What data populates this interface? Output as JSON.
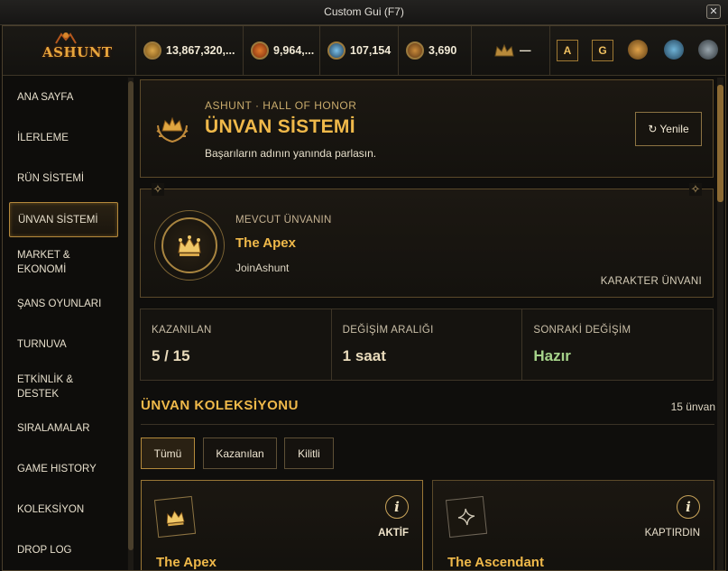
{
  "window": {
    "title": "Custom Gui (F7)"
  },
  "brand": {
    "logo_text": "ASHUNT"
  },
  "resources": [
    {
      "icon": "gold-coin-icon",
      "value": "13,867,320,..."
    },
    {
      "icon": "red-coin-icon",
      "value": "9,964,..."
    },
    {
      "icon": "blue-orb-icon",
      "value": "107,154"
    },
    {
      "icon": "star-coin-icon",
      "value": "3,690"
    },
    {
      "icon": "crown-rank-icon",
      "value": "—"
    }
  ],
  "quick_buttons": {
    "a": "A",
    "g": "G"
  },
  "sidebar": {
    "items": [
      {
        "id": "home",
        "label": "ANA SAYFA"
      },
      {
        "id": "progress",
        "label": "İLERLEME"
      },
      {
        "id": "rune",
        "label": "RÜN SİSTEMİ"
      },
      {
        "id": "title",
        "label": "ÜNVAN SİSTEMİ"
      },
      {
        "id": "market",
        "label": "MARKET & EKONOMİ"
      },
      {
        "id": "luck",
        "label": "ŞANS OYUNLARI"
      },
      {
        "id": "tournament",
        "label": "TURNUVA"
      },
      {
        "id": "event",
        "label": "ETKİNLİK & DESTEK"
      },
      {
        "id": "rankings",
        "label": "SIRALAMALAR"
      },
      {
        "id": "history",
        "label": "GAME HISTORY"
      },
      {
        "id": "collection",
        "label": "KOLEKSİYON"
      },
      {
        "id": "droplog",
        "label": "DROP LOG"
      }
    ],
    "active": "ÜNVAN SİSTEMİ"
  },
  "header": {
    "eyebrow": "ASHUNT · HALL OF HONOR",
    "title": "ÜNVAN SİSTEMİ",
    "subtitle": "Başarıların adının yanında parlasın.",
    "refresh_label": "Yenile"
  },
  "current": {
    "label": "MEVCUT ÜNVANIN",
    "name": "The Apex",
    "guild": "JoinAshunt",
    "kind": "KARAKTER ÜNVANI"
  },
  "stats": [
    {
      "key": "KAZANILAN",
      "value": "5 / 15"
    },
    {
      "key": "DEĞİŞİM ARALIĞI",
      "value": "1 saat"
    },
    {
      "key": "SONRAKİ DEĞİŞİM",
      "value": "Hazır"
    }
  ],
  "collection": {
    "title": "ÜNVAN KOLEKSİYONU",
    "count": "15 ünvan",
    "filters": [
      "Tümü",
      "Kazanılan",
      "Kilitli"
    ],
    "cards": [
      {
        "name": "The Apex",
        "state": "AKTİF",
        "icon": "crown-icon"
      },
      {
        "name": "The Ascendant",
        "state": "KAPTIRDIN",
        "icon": "sparkle-icon"
      }
    ]
  },
  "colors": {
    "accent": "#f0b94a",
    "ready": "#a6d38a",
    "border": "#5c4a2a"
  }
}
